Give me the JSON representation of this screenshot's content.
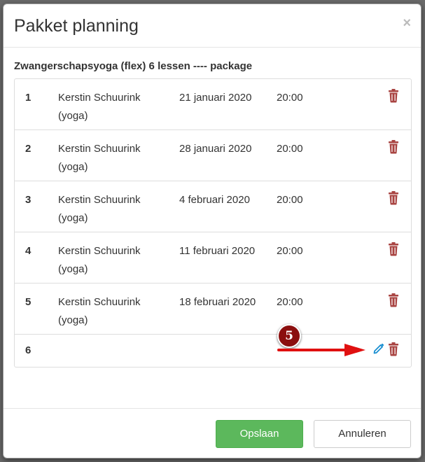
{
  "modal": {
    "title": "Pakket planning",
    "close_label": "×"
  },
  "package": {
    "title": "Zwangerschapsyoga (flex) 6 lessen ---- package"
  },
  "rows": [
    {
      "num": "1",
      "teacher": "Kerstin Schuurink (yoga)",
      "date": "21 januari 2020",
      "time": "20:00"
    },
    {
      "num": "2",
      "teacher": "Kerstin Schuurink (yoga)",
      "date": "28 januari 2020",
      "time": "20:00"
    },
    {
      "num": "3",
      "teacher": "Kerstin Schuurink (yoga)",
      "date": "4 februari 2020",
      "time": "20:00"
    },
    {
      "num": "4",
      "teacher": "Kerstin Schuurink (yoga)",
      "date": "11 februari 2020",
      "time": "20:00"
    },
    {
      "num": "5",
      "teacher": "Kerstin Schuurink (yoga)",
      "date": "18 februari 2020",
      "time": "20:00"
    },
    {
      "num": "6",
      "teacher": "",
      "date": "",
      "time": ""
    }
  ],
  "annotation": {
    "step": "5"
  },
  "footer": {
    "save_label": "Opslaan",
    "cancel_label": "Annuleren"
  },
  "colors": {
    "trash": "#a94442",
    "pencil": "#1a8fd1",
    "save": "#5cb85c",
    "annotation": "#8b0f0f",
    "arrow": "#e01010"
  },
  "icons": {
    "row_delete": "trash-icon",
    "row_edit": "pencil-icon"
  }
}
